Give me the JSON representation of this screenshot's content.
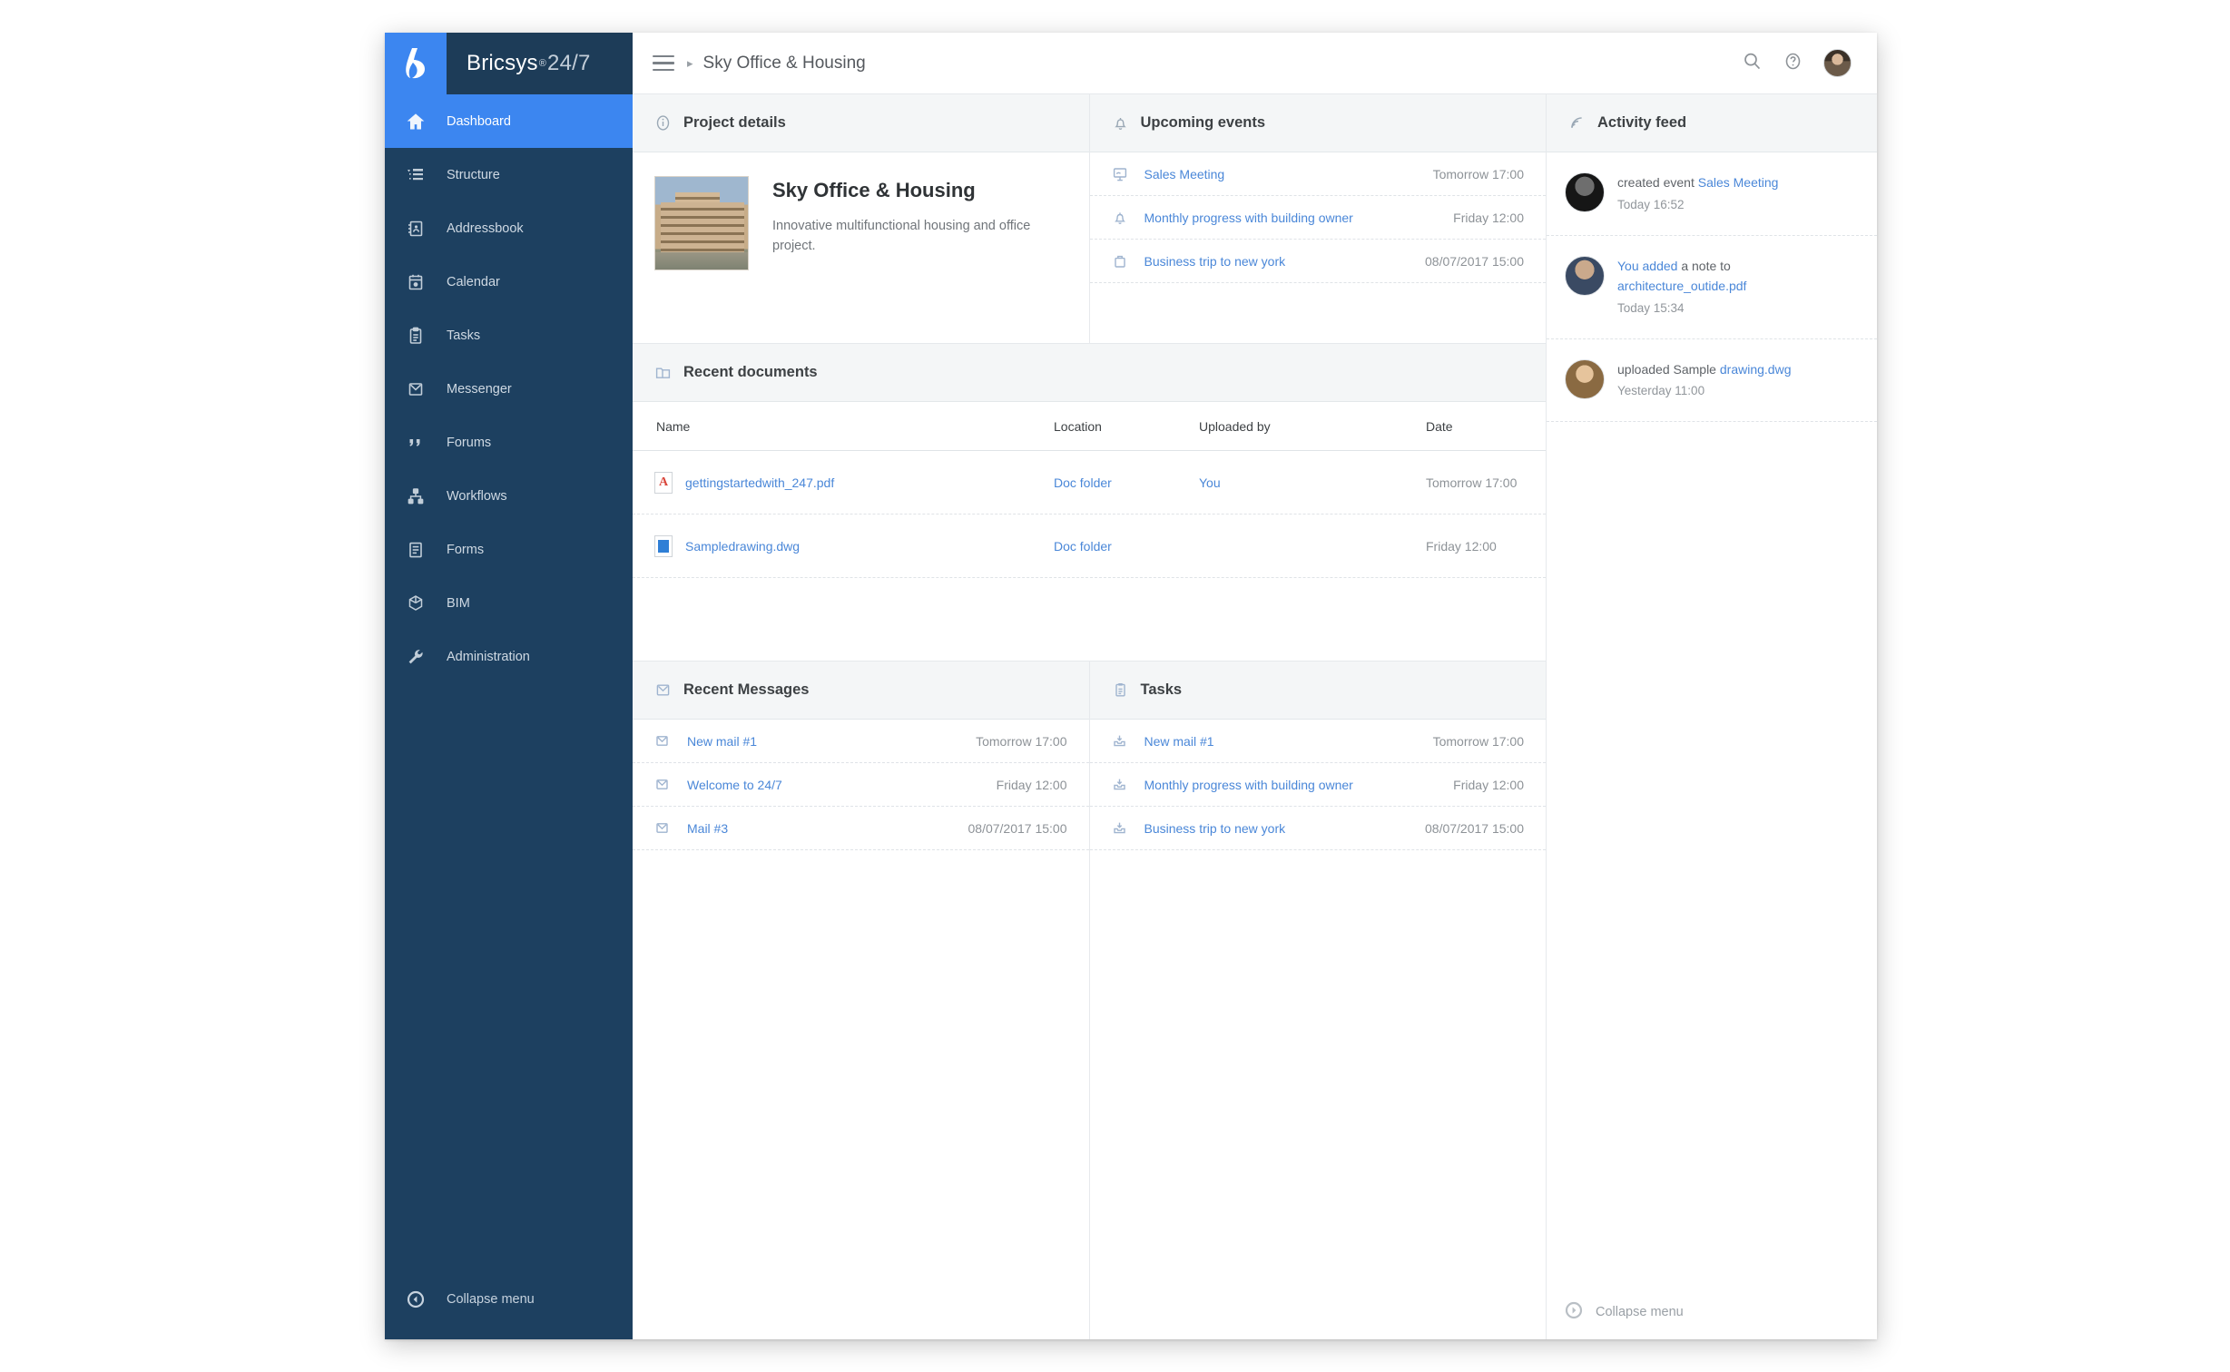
{
  "brand": {
    "name": "Bricsys",
    "registered": "®",
    "suffix": "24/7",
    "logo_icon": "bricsys-logo-icon"
  },
  "topbar": {
    "menu_icon": "hamburger-menu-icon",
    "breadcrumb_separator": "▸",
    "breadcrumb": "Sky Office & Housing",
    "search_icon": "search-icon",
    "help_icon": "help-icon",
    "avatar": "user-avatar"
  },
  "sidebar": {
    "items": [
      {
        "label": "Dashboard",
        "icon": "home-icon",
        "active": true
      },
      {
        "label": "Structure",
        "icon": "structure-icon",
        "active": false
      },
      {
        "label": "Addressbook",
        "icon": "addressbook-icon",
        "active": false
      },
      {
        "label": "Calendar",
        "icon": "calendar-icon",
        "active": false
      },
      {
        "label": "Tasks",
        "icon": "clipboard-icon",
        "active": false
      },
      {
        "label": "Messenger",
        "icon": "envelope-icon",
        "active": false
      },
      {
        "label": "Forums",
        "icon": "quote-icon",
        "active": false
      },
      {
        "label": "Workflows",
        "icon": "workflow-icon",
        "active": false
      },
      {
        "label": "Forms",
        "icon": "form-icon",
        "active": false
      },
      {
        "label": "BIM",
        "icon": "cube-icon",
        "active": false
      },
      {
        "label": "Administration",
        "icon": "wrench-icon",
        "active": false
      }
    ],
    "collapse_label": "Collapse menu",
    "collapse_icon": "collapse-left-icon"
  },
  "project_details": {
    "title": "Project details",
    "icon": "info-icon",
    "project_name": "Sky Office & Housing",
    "description": "Innovative multifunctional housing and office project.",
    "thumbnail": "project-thumbnail"
  },
  "upcoming_events": {
    "title": "Upcoming events",
    "icon": "bell-icon",
    "items": [
      {
        "label": "Sales Meeting",
        "time": "Tomorrow 17:00",
        "icon": "presentation-icon"
      },
      {
        "label": "Monthly progress with building owner",
        "time": "Friday 12:00",
        "icon": "bell-icon"
      },
      {
        "label": "Business trip to new york",
        "time": "08/07/2017 15:00",
        "icon": "briefcase-icon"
      }
    ]
  },
  "activity_feed": {
    "title": "Activity feed",
    "icon": "rss-icon",
    "items": [
      {
        "avatar": "avatar-1",
        "prefix": "created event ",
        "link": "Sales Meeting",
        "suffix": "",
        "time": "Today 16:52"
      },
      {
        "avatar": "avatar-2",
        "prefix": "",
        "link": "You added",
        "suffix": " a note to ",
        "link2": "architecture_outide.pdf",
        "time": "Today 15:34"
      },
      {
        "avatar": "avatar-3",
        "prefix": "uploaded Sample ",
        "link": "drawing.dwg",
        "suffix": "",
        "time": "Yesterday 11:00"
      }
    ],
    "collapse_label": "Collapse menu",
    "collapse_icon": "collapse-right-icon"
  },
  "recent_documents": {
    "title": "Recent documents",
    "icon": "folder-icon",
    "columns": [
      "Name",
      "Location",
      "Uploaded by",
      "Date"
    ],
    "rows": [
      {
        "icon": "pdf-file-icon",
        "name": "gettingstartedwith_247.pdf",
        "location": "Doc folder",
        "uploaded_by": "You",
        "date": "Tomorrow 17:00"
      },
      {
        "icon": "dwg-file-icon",
        "name": "Sampledrawing.dwg",
        "location": "Doc folder",
        "uploaded_by": "",
        "date": "Friday 12:00"
      }
    ]
  },
  "recent_messages": {
    "title": "Recent Messages",
    "icon": "envelope-icon",
    "items": [
      {
        "label": "New mail #1",
        "time": "Tomorrow 17:00",
        "icon": "envelope-icon"
      },
      {
        "label": "Welcome to 24/7",
        "time": "Friday 12:00",
        "icon": "envelope-icon"
      },
      {
        "label": "Mail #3",
        "time": "08/07/2017 15:00",
        "icon": "envelope-icon"
      }
    ]
  },
  "tasks": {
    "title": "Tasks",
    "icon": "clipboard-icon",
    "items": [
      {
        "label": "New mail #1",
        "time": "Tomorrow 17:00",
        "icon": "task-inbox-icon"
      },
      {
        "label": "Monthly progress with building owner",
        "time": "Friday 12:00",
        "icon": "task-inbox-icon"
      },
      {
        "label": "Business trip to new york",
        "time": "08/07/2017 15:00",
        "icon": "task-inbox-icon"
      }
    ]
  },
  "colors": {
    "accent": "#3c86f0",
    "sidebar": "#1d4060",
    "sidebar_brand": "#1d3c58",
    "link": "#4a87d8",
    "panel_header_bg": "#f4f6f7",
    "muted_text": "#8d9297"
  }
}
